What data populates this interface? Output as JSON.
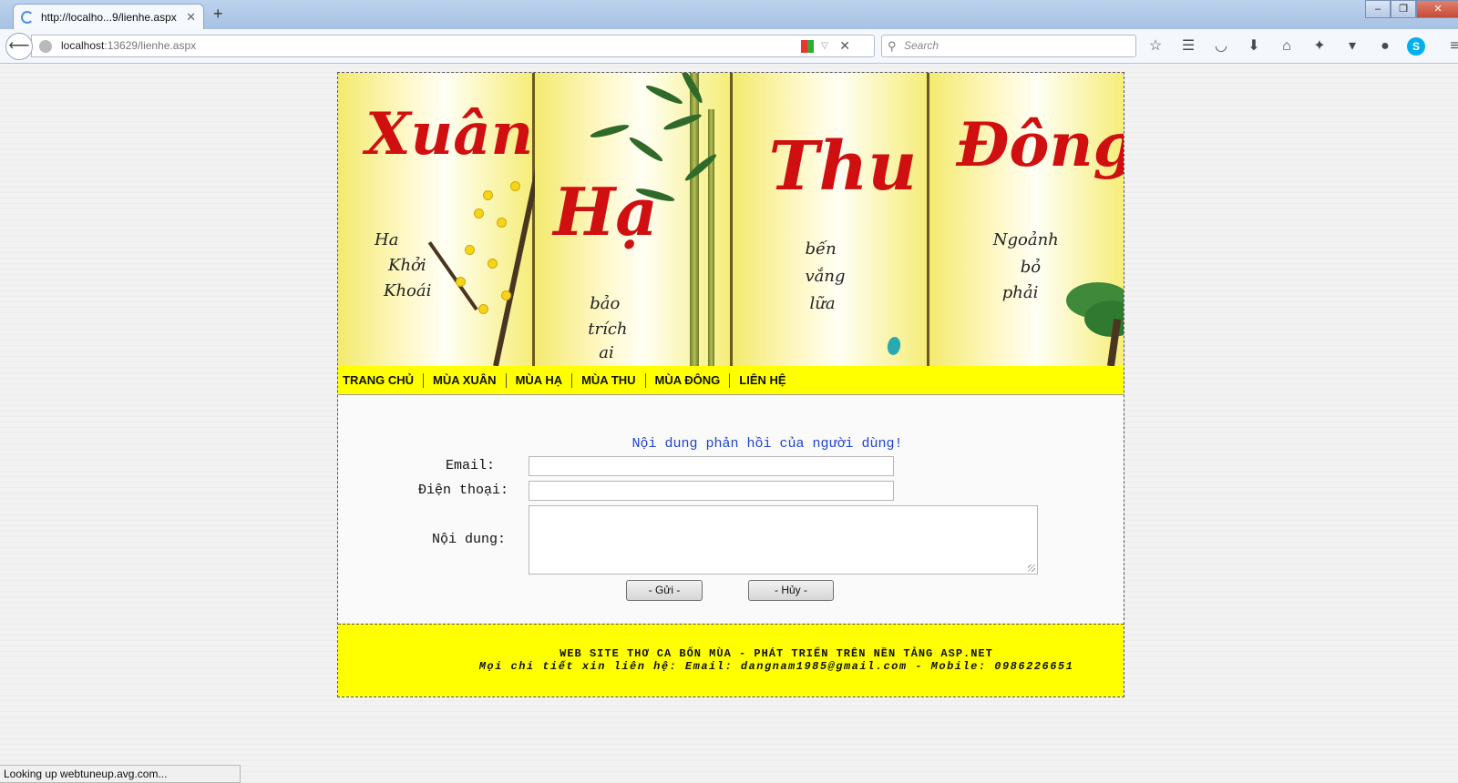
{
  "browser": {
    "tab_title": "http://localho...9/lienhe.aspx",
    "tab_close": "✕",
    "new_tab": "+",
    "url_host": "localhost",
    "url_rest": ":13629/lienhe.aspx",
    "search_placeholder": "Search",
    "window_controls": [
      "–",
      "❐",
      "✕"
    ],
    "toolbar_icons": [
      "star-icon",
      "reading-list-icon",
      "pocket-icon",
      "download-icon",
      "home-icon",
      "extension-icon",
      "dropdown-icon",
      "chat-icon",
      "skype-icon",
      "menu-icon"
    ]
  },
  "banner": {
    "panels": [
      {
        "title": "Xuân",
        "sub": [
          "Ha",
          "Khởi",
          "Khoái"
        ]
      },
      {
        "title": "Hạ",
        "sub": [
          "bảo",
          "trích",
          "ai"
        ]
      },
      {
        "title": "Thu",
        "sub": [
          "bến",
          "vắng",
          "lữa"
        ]
      },
      {
        "title": "Đông",
        "sub": [
          "Ngoảnh",
          "bỏ",
          "phải"
        ]
      }
    ]
  },
  "menu": {
    "items": [
      "TRANG CHỦ",
      "MÙA XUÂN",
      "MÙA HẠ",
      "MÙA THU",
      "MÙA ĐÔNG",
      "LIÊN HỆ"
    ]
  },
  "form": {
    "title": "Nội dung phản hồi của người dùng!",
    "email_label": "Email:",
    "phone_label": "Điện thoại:",
    "content_label": "Nội dung:",
    "email_value": "",
    "phone_value": "",
    "content_value": "",
    "submit_label": "- Gửi -",
    "cancel_label": "- Hủy -"
  },
  "footer": {
    "line1": "WEB SITE THƠ CA BỐN MÙA - PHÁT TRIỂN TRÊN NỀN TẢNG ASP.NET",
    "line2": "Mọi chi tiết xin liên hệ: Email: dangnam1985@gmail.com - Mobile: 0986226651"
  },
  "status": {
    "text": "Looking up webtuneup.avg.com..."
  },
  "colors": {
    "menu_bg": "#ffff00",
    "footer_bg": "#ffff00",
    "form_title": "#2244cc",
    "calligraphy": "#d01010"
  }
}
